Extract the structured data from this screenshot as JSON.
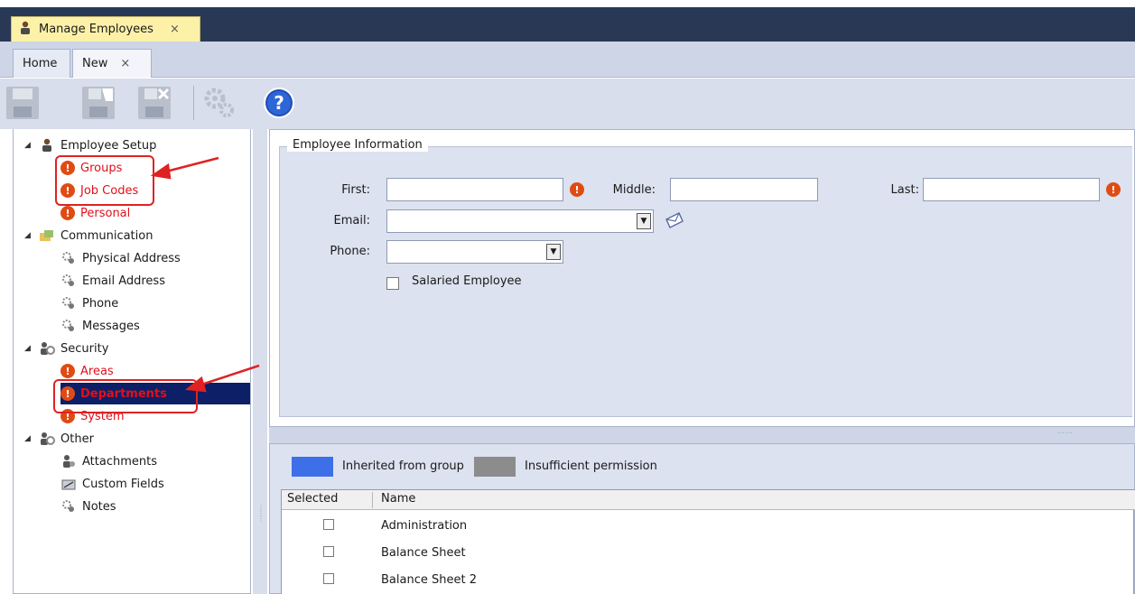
{
  "window_tab": {
    "title": "Manage Employees",
    "close": "×"
  },
  "inner_tabs": [
    {
      "label": "Home"
    },
    {
      "label": "New",
      "close": "×"
    }
  ],
  "toolbar": {
    "buttons": [
      "save-icon",
      "save-close-icon",
      "discard-icon",
      "gear-icon",
      "help-icon"
    ],
    "help_glyph": "?"
  },
  "tree": {
    "groups": [
      {
        "label": "Employee Setup",
        "items": [
          {
            "label": "Groups",
            "error": true
          },
          {
            "label": "Job Codes",
            "error": true
          },
          {
            "label": "Personal",
            "error": true
          }
        ]
      },
      {
        "label": "Communication",
        "items": [
          {
            "label": "Physical Address"
          },
          {
            "label": "Email Address"
          },
          {
            "label": "Phone"
          },
          {
            "label": "Messages"
          }
        ]
      },
      {
        "label": "Security",
        "items": [
          {
            "label": "Areas",
            "error": true
          },
          {
            "label": "Departments",
            "error": true,
            "selected": true
          },
          {
            "label": "System",
            "error": true
          }
        ]
      },
      {
        "label": "Other",
        "items": [
          {
            "label": "Attachments"
          },
          {
            "label": "Custom Fields"
          },
          {
            "label": "Notes"
          }
        ]
      }
    ],
    "error_glyph": "!"
  },
  "form": {
    "section_title": "Employee Information",
    "first_label": "First:",
    "middle_label": "Middle:",
    "last_label": "Last:",
    "email_label": "Email:",
    "phone_label": "Phone:",
    "salaried_label": "Salaried Employee",
    "first_value": "",
    "middle_value": "",
    "last_value": "",
    "email_value": "",
    "phone_value": ""
  },
  "legend": {
    "inherited_label": "Inherited from group",
    "inherited_color": "#3d6fe8",
    "insufficient_label": "Insufficient permission",
    "insufficient_color": "#8c8c8c"
  },
  "grid": {
    "columns": [
      "Selected",
      "Name"
    ],
    "rows": [
      "Administration",
      "Balance Sheet",
      "Balance Sheet 2"
    ]
  },
  "colors": {
    "accent_dark": "#293955",
    "error": "#e04b14",
    "annotation": "#e02222"
  }
}
